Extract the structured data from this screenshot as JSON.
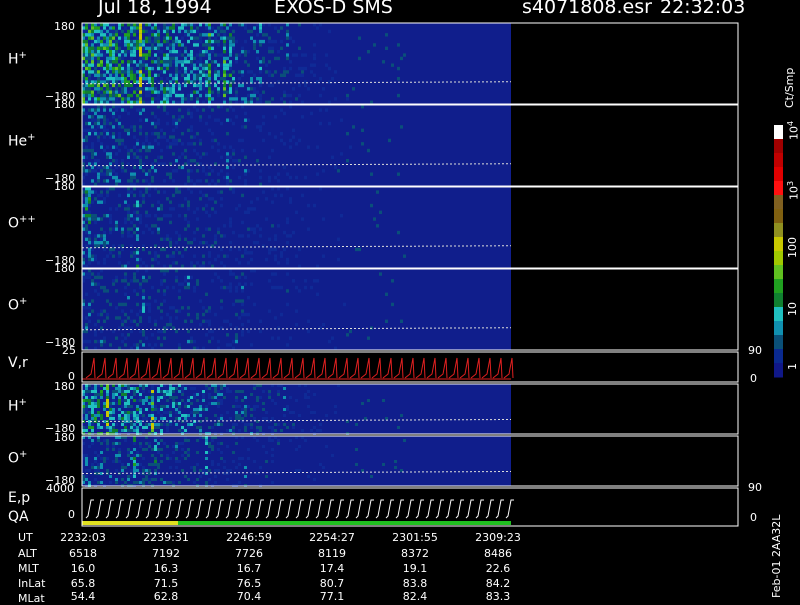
{
  "header": {
    "date": "Jul 18, 1994",
    "instrument": "EXOS-D SMS",
    "filename": "s4071808.esr",
    "time": "22:32:03"
  },
  "colorbar": {
    "units_label": "Ct/Smp",
    "tick_labels": [
      "10",
      "10",
      "100",
      "10",
      "1"
    ],
    "exponents": [
      "4",
      "3",
      "",
      "",
      ""
    ],
    "colors": [
      "#ffffff",
      "#a00000",
      "#c00000",
      "#e00000",
      "#ff1010",
      "#806020",
      "#806010",
      "#909020",
      "#c8c800",
      "#a0c800",
      "#60c020",
      "#20a020",
      "#108030",
      "#20c0c0",
      "#1090b0",
      "#0a5078",
      "#0a2a90",
      "#101888"
    ]
  },
  "panels": [
    {
      "name": "H+",
      "label": "H",
      "charge": "+",
      "ymax": "180",
      "ymin": "−180"
    },
    {
      "name": "He+",
      "label": "He",
      "charge": "+",
      "ymax": "180",
      "ymin": "−180"
    },
    {
      "name": "O++",
      "label": "O",
      "charge": "++",
      "ymax": "180",
      "ymin": "−180"
    },
    {
      "name": "O+",
      "label": "O",
      "charge": "+",
      "ymax": "180",
      "ymin": "−180"
    },
    {
      "name": "Vr",
      "label": "V,r",
      "charge": "",
      "ymax": "25",
      "ymin": "0",
      "right_top": "90",
      "right_bottom": "0"
    },
    {
      "name": "H+2",
      "label": "H",
      "charge": "+",
      "ymax": "180",
      "ymin": "−180"
    },
    {
      "name": "O+2",
      "label": "O",
      "charge": "+",
      "ymax": "180",
      "ymin": "−180"
    },
    {
      "name": "Ep",
      "label": "E,p",
      "label2": "QA",
      "charge": "",
      "ymax": "4000",
      "ymin": "0",
      "right_top": "90",
      "right_bottom": "0"
    }
  ],
  "ephemeris": {
    "rows": [
      {
        "label": "UT",
        "values": [
          "2232:03",
          "2239:31",
          "2246:59",
          "2254:27",
          "2301:55",
          "2309:23"
        ]
      },
      {
        "label": "ALT",
        "values": [
          "6518",
          "7192",
          "7726",
          "8119",
          "8372",
          "8486"
        ]
      },
      {
        "label": "MLT",
        "values": [
          "16.0",
          "16.3",
          "16.7",
          "17.4",
          "19.1",
          "22.6"
        ]
      },
      {
        "label": "InLat",
        "values": [
          "65.8",
          "71.5",
          "76.5",
          "80.7",
          "83.8",
          "84.2"
        ]
      },
      {
        "label": "MLat",
        "values": [
          "54.4",
          "62.8",
          "70.4",
          "77.1",
          "82.4",
          "83.3"
        ]
      }
    ]
  },
  "side_text": "Feb-01 2AA32L",
  "chart_data": {
    "type": "heatmap",
    "title": "Jul 18, 1994 EXOS-D SMS",
    "xlabel": "UT",
    "x_ticks": [
      "2232:03",
      "2239:31",
      "2246:59",
      "2254:27",
      "2301:55",
      "2309:23"
    ],
    "series": [
      {
        "name": "H+",
        "ylim": [
          -180,
          180
        ]
      },
      {
        "name": "He+",
        "ylim": [
          -180,
          180
        ]
      },
      {
        "name": "O++",
        "ylim": [
          -180,
          180
        ]
      },
      {
        "name": "O+",
        "ylim": [
          -180,
          180
        ]
      },
      {
        "name": "V,r",
        "ylim": [
          0,
          25
        ]
      },
      {
        "name": "H+",
        "ylim": [
          -180,
          180
        ]
      },
      {
        "name": "O+",
        "ylim": [
          -180,
          180
        ]
      },
      {
        "name": "E,p",
        "ylim": [
          0,
          4000
        ]
      }
    ],
    "colorbar_range": [
      1,
      10000
    ],
    "colorbar_scale": "log"
  }
}
